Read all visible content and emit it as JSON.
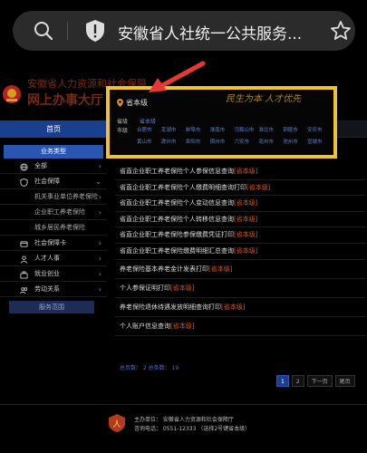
{
  "browser": {
    "url_text": "安徽省人社统一公共服务..."
  },
  "header": {
    "title": "安徽省人力资源和社会保障",
    "subtitle": "网上办事大厅"
  },
  "region": {
    "current_label": "省本级",
    "slogan": "民生为本  人才优先",
    "province_label": "省级",
    "province_link": "省本级",
    "city_label": "市级",
    "cities": [
      "合肥市",
      "芜湖市",
      "蚌埠市",
      "淮南市",
      "马鞍山市",
      "淮北市",
      "铜陵市",
      "安庆市",
      "黄山市",
      "滁州市",
      "阜阳市",
      "宿州市",
      "六安市",
      "亳州市",
      "池州市",
      "宣城市"
    ]
  },
  "nav": {
    "home": "首页"
  },
  "sidebar": {
    "header": "业务类型",
    "items": [
      {
        "label": "全部",
        "icon": "globe-icon",
        "chevron": "›",
        "sub": false
      },
      {
        "label": "社会保障",
        "icon": "shield-icon",
        "chevron": "⌄",
        "sub": false
      },
      {
        "label": "机关事业单位养老保险",
        "chevron": "›",
        "sub": true
      },
      {
        "label": "企业职工养老保险",
        "chevron": "›",
        "sub": true
      },
      {
        "label": "城乡居民养老保险",
        "chevron": "",
        "sub": true
      },
      {
        "label": "社会保障卡",
        "icon": "card-icon",
        "chevron": "›",
        "sub": false
      },
      {
        "label": "人才人事",
        "icon": "person-icon",
        "chevron": "›",
        "sub": false
      },
      {
        "label": "就业创业",
        "icon": "briefcase-icon",
        "chevron": "›",
        "sub": false
      },
      {
        "label": "劳动关系",
        "icon": "users-icon",
        "chevron": "›",
        "sub": false
      }
    ],
    "service_range": "服务范围"
  },
  "services": [
    {
      "title": "省直企业职工养老保险个人参保信息查询",
      "tag": "[省本级]"
    },
    {
      "title": "省直企业职工养老保险个人缴费明细查询打印",
      "tag": "[省本级]"
    },
    {
      "title": "省直企业职工养老保险个人变动信息查询",
      "tag": "[省本级]"
    },
    {
      "title": "省直企业职工养老保险个人转移信息查询",
      "tag": "[省本级]"
    },
    {
      "title": "省直企业职工养老保险参保缴费凭证打印",
      "tag": "[省本级]"
    },
    {
      "title": "省直企业职工养老保险缴费明细汇总查询",
      "tag": "[省本级]"
    },
    {
      "title": "养老保险基本养老金计发表打印",
      "tag": "[省本级]"
    },
    {
      "title": "个人参保证明打印",
      "tag": "[省本级]"
    },
    {
      "title": "养老保险退休待遇发放明细查询打印",
      "tag": "[省本级]"
    },
    {
      "title": "个人账户信息查询",
      "tag": "[省本级]"
    }
  ],
  "pagination": {
    "info": "总页数：  2  总条数：  19",
    "pages": [
      "1",
      "2"
    ],
    "active": "1",
    "next": "下一页",
    "last": "尾页"
  },
  "footer": {
    "org": "主办单位：  安徽省人力资源和社会保障厅",
    "phone": "咨询电话：  0551-12333  （选择2号键省本级）"
  },
  "colors": {
    "accent_blue": "#1b3f8f",
    "highlight_yellow": "#f2c12e",
    "arrow_red": "#e53935",
    "tag_orange": "#d05a20"
  }
}
